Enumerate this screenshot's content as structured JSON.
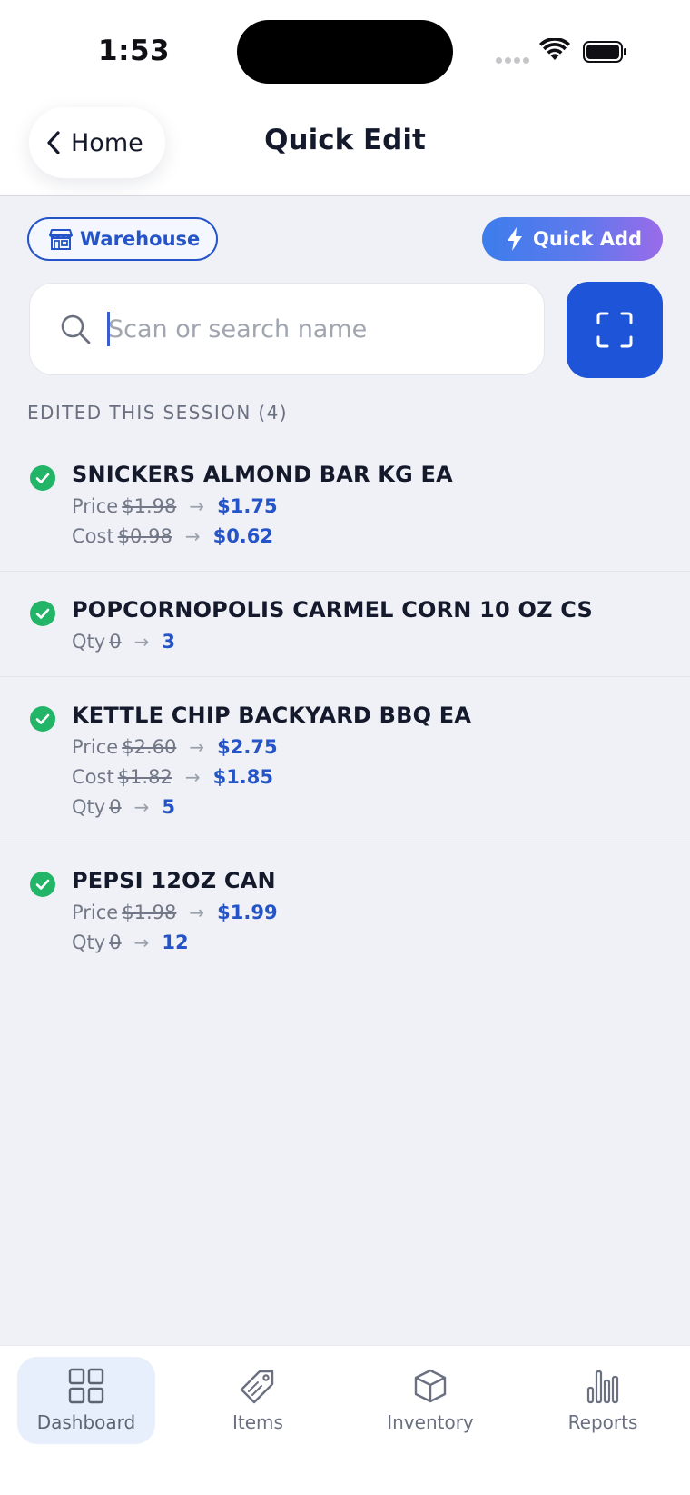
{
  "status_bar": {
    "time": "1:53"
  },
  "header": {
    "back_label": "Home",
    "title": "Quick Edit"
  },
  "location_chip": {
    "label": "Warehouse"
  },
  "quick_add": {
    "label": "Quick Add"
  },
  "search": {
    "placeholder": "Scan or search name",
    "value": ""
  },
  "section": {
    "label": "EDITED THIS SESSION (4)"
  },
  "items": [
    {
      "name": "SNICKERS ALMOND BAR KG EA",
      "changes": [
        {
          "field": "Price",
          "old": "$1.98",
          "new": "$1.75"
        },
        {
          "field": "Cost",
          "old": "$0.98",
          "new": "$0.62"
        }
      ]
    },
    {
      "name": "POPCORNOPOLIS CARMEL CORN 10 OZ CS",
      "changes": [
        {
          "field": "Qty",
          "old": "0",
          "new": "3"
        }
      ]
    },
    {
      "name": "KETTLE CHIP BACKYARD BBQ EA",
      "changes": [
        {
          "field": "Price",
          "old": "$2.60",
          "new": "$2.75"
        },
        {
          "field": "Cost",
          "old": "$1.82",
          "new": "$1.85"
        },
        {
          "field": "Qty",
          "old": "0",
          "new": "5"
        }
      ]
    },
    {
      "name": "PEPSI 12OZ CAN",
      "changes": [
        {
          "field": "Price",
          "old": "$1.98",
          "new": "$1.99"
        },
        {
          "field": "Qty",
          "old": "0",
          "new": "12"
        }
      ]
    }
  ],
  "arrow_glyph": "→",
  "nav": [
    {
      "label": "Dashboard",
      "icon": "grid-icon",
      "active": true
    },
    {
      "label": "Items",
      "icon": "tag-icon",
      "active": false
    },
    {
      "label": "Inventory",
      "icon": "box-icon",
      "active": false
    },
    {
      "label": "Reports",
      "icon": "bar-chart-icon",
      "active": false
    }
  ],
  "colors": {
    "accent": "#2454c8",
    "success": "#22b567",
    "background": "#eff1f6"
  }
}
